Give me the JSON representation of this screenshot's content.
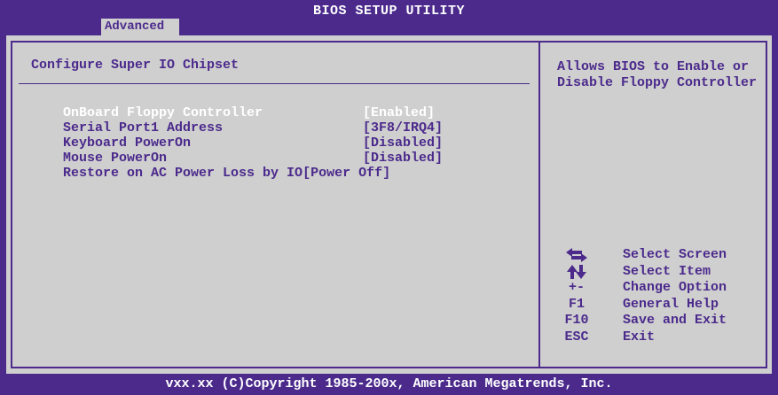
{
  "title": "BIOS SETUP UTILITY",
  "active_tab": "Advanced",
  "section_title": "Configure Super IO Chipset",
  "settings": [
    {
      "label": "OnBoard Floppy Controller",
      "value": "[Enabled]"
    },
    {
      "label": "Serial Port1 Address",
      "value": "[3F8/IRQ4]"
    },
    {
      "label": "Keyboard PowerOn",
      "value": "[Disabled]"
    },
    {
      "label": "Mouse PowerOn",
      "value": "[Disabled]"
    },
    {
      "label": "Restore on AC Power Loss by IO",
      "value": "[Power Off]"
    }
  ],
  "help_text": "Allows BIOS to Enable or Disable Floppy Controller",
  "key_legend": [
    {
      "key": "",
      "icon": "left-right-arrows-icon",
      "desc": "Select Screen"
    },
    {
      "key": "",
      "icon": "up-down-arrows-icon",
      "desc": "Select Item"
    },
    {
      "key": "+-",
      "desc": "Change Option"
    },
    {
      "key": "F1",
      "desc": "General Help"
    },
    {
      "key": "F10",
      "desc": "Save and Exit"
    },
    {
      "key": "ESC",
      "desc": "Exit"
    }
  ],
  "footer": "vxx.xx (C)Copyright 1985-200x, American Megatrends, Inc.",
  "colors": {
    "background": "#4b2a8c",
    "panel": "#cfcfcf",
    "highlight_text": "#ffffff"
  }
}
